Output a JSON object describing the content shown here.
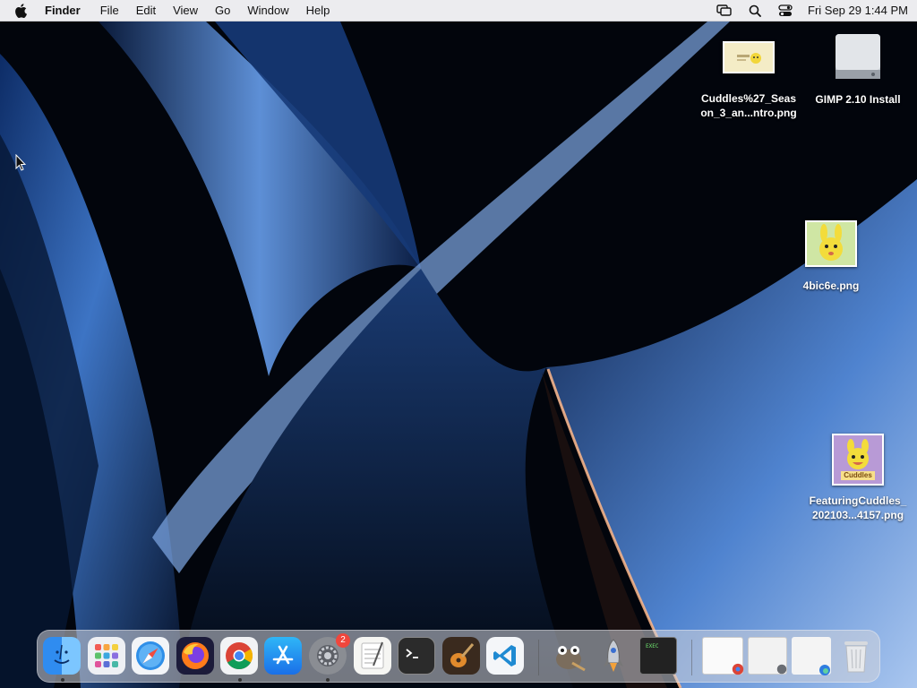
{
  "menubar": {
    "app_name": "Finder",
    "menus": [
      "File",
      "Edit",
      "View",
      "Go",
      "Window",
      "Help"
    ],
    "clock": "Fri Sep 29  1:44 PM",
    "status_icons": [
      "screen-mirroring-icon",
      "spotlight-search-icon",
      "control-center-icon"
    ]
  },
  "desktop": {
    "icons": [
      {
        "label_line1": "Cuddles%27_Seas",
        "label_line2": "on_3_an...ntro.png"
      },
      {
        "label_line1": "GIMP 2.10 Install",
        "label_line2": ""
      },
      {
        "label_line1": "4bic6e.png",
        "label_line2": ""
      },
      {
        "label_line1": "FeaturingCuddles_",
        "label_line2": "202103...4157.png"
      }
    ],
    "thumb_text": "Cuddles"
  },
  "dock": {
    "apps": [
      "Finder",
      "Launchpad",
      "Safari",
      "Firefox",
      "Google Chrome",
      "App Store",
      "System Settings",
      "TextEdit",
      "Terminal",
      "GarageBand",
      "Visual Studio Code",
      "GIMP",
      "Rocket",
      "Console",
      "Chrome Window",
      "Finder Window",
      "Launchpad Window",
      "Trash"
    ],
    "settings_badge": "2",
    "console_text": "EXEC"
  },
  "colors": {
    "menubar_bg": "#ececef",
    "accent_blue": "#2f7de0",
    "badge_red": "#f0463c"
  }
}
